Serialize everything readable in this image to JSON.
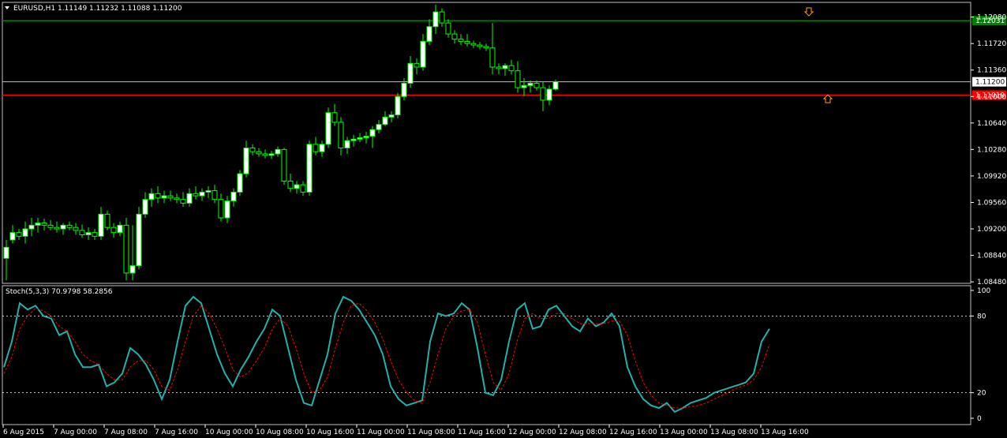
{
  "header": {
    "symbol_line": "EURUSD,H1  1.11149 1.11232 1.11088 1.11200",
    "stoch_line": "Stoch(5,3,3) 70.9798 58.2856"
  },
  "colors": {
    "background": "#000000",
    "bull_candle": "#ffffff",
    "bear_candle": "#000000",
    "candle_outline": "#00ff00",
    "wick": "#00ff00",
    "stoch_main": "#20b2aa",
    "stoch_signal": "#ff0000",
    "green_level": "#008000",
    "red_level": "#ff0000",
    "bid_line": "#c0c0c0",
    "arrow": "#ffa500",
    "grid_dotted": "#ffffff"
  },
  "chart_data": [
    {
      "type": "candlestick",
      "symbol": "EURUSD",
      "timeframe": "H1",
      "ylim": [
        1.0846,
        1.1228
      ],
      "y_ticks": [
        "1.12080",
        "1.11720",
        "1.11360",
        "1.11000",
        "1.10640",
        "1.10280",
        "1.09920",
        "1.09560",
        "1.09200",
        "1.08840",
        "1.08480"
      ],
      "price_labels": [
        {
          "name": "resistance",
          "value": 1.12031,
          "text": "1.12031",
          "color": "#008000"
        },
        {
          "name": "bid",
          "value": 1.112,
          "text": "1.11200",
          "color": "#ffffff"
        },
        {
          "name": "support",
          "value": 1.11019,
          "text": "1.11019",
          "color": "#ff0000"
        }
      ],
      "x_labels": [
        "6 Aug 2015",
        "7 Aug 00:00",
        "7 Aug 08:00",
        "7 Aug 16:00",
        "10 Aug 00:00",
        "10 Aug 08:00",
        "10 Aug 16:00",
        "11 Aug 00:00",
        "11 Aug 08:00",
        "11 Aug 16:00",
        "12 Aug 00:00",
        "12 Aug 08:00",
        "12 Aug 16:00",
        "13 Aug 00:00",
        "13 Aug 08:00",
        "13 Aug 16:00"
      ],
      "arrows": [
        {
          "direction": "down",
          "index": 170,
          "value": 1.1214
        },
        {
          "direction": "up",
          "index": 174,
          "value": 1.1098
        }
      ],
      "ohlc": [
        [
          1.088,
          1.0905,
          1.085,
          1.0895
        ],
        [
          1.0905,
          1.0925,
          1.09,
          1.0915
        ],
        [
          1.0915,
          1.092,
          1.0905,
          1.091
        ],
        [
          1.091,
          1.093,
          1.09,
          1.092
        ],
        [
          1.092,
          1.0935,
          1.091,
          1.0925
        ],
        [
          1.0925,
          1.0935,
          1.0915,
          1.0928
        ],
        [
          1.0928,
          1.0934,
          1.0918,
          1.0925
        ],
        [
          1.0925,
          1.0932,
          1.0918,
          1.0922
        ],
        [
          1.0922,
          1.093,
          1.0915,
          1.092
        ],
        [
          1.092,
          1.0928,
          1.0912,
          1.0925
        ],
        [
          1.0925,
          1.093,
          1.0918,
          1.0922
        ],
        [
          1.0922,
          1.0928,
          1.0912,
          1.0918
        ],
        [
          1.0918,
          1.0926,
          1.0908,
          1.0912
        ],
        [
          1.0912,
          1.0922,
          1.0905,
          1.0915
        ],
        [
          1.0915,
          1.092,
          1.0905,
          1.091
        ],
        [
          1.091,
          1.095,
          1.0905,
          1.094
        ],
        [
          1.094,
          1.0945,
          1.0918,
          1.0922
        ],
        [
          1.0922,
          1.0928,
          1.0908,
          1.0915
        ],
        [
          1.0915,
          1.093,
          1.091,
          1.0925
        ],
        [
          1.0925,
          1.0935,
          1.085,
          1.086
        ],
        [
          1.086,
          1.0925,
          1.085,
          1.087
        ],
        [
          1.087,
          1.095,
          1.0865,
          1.094
        ],
        [
          1.094,
          1.097,
          1.0935,
          1.096
        ],
        [
          1.096,
          1.0975,
          1.095,
          1.0968
        ],
        [
          1.0968,
          1.0978,
          1.0955,
          1.0962
        ],
        [
          1.0962,
          1.0972,
          1.0955,
          1.0965
        ],
        [
          1.0965,
          1.0972,
          1.0958,
          1.0962
        ],
        [
          1.0962,
          1.0968,
          1.0955,
          1.096
        ],
        [
          1.096,
          1.097,
          1.095,
          1.0955
        ],
        [
          1.0955,
          1.0975,
          1.095,
          1.0968
        ],
        [
          1.0968,
          1.0978,
          1.096,
          1.0965
        ],
        [
          1.0965,
          1.0975,
          1.0958,
          1.097
        ],
        [
          1.097,
          1.0978,
          1.0962,
          1.0972
        ],
        [
          1.0972,
          1.098,
          1.0955,
          1.096
        ],
        [
          1.096,
          1.0968,
          1.093,
          1.0935
        ],
        [
          1.0935,
          1.0965,
          1.0928,
          1.0958
        ],
        [
          1.0958,
          1.0975,
          1.095,
          1.097
        ],
        [
          1.097,
          1.1,
          1.0965,
          1.0995
        ],
        [
          1.0995,
          1.104,
          1.099,
          1.103
        ],
        [
          1.103,
          1.1035,
          1.102,
          1.1025
        ],
        [
          1.1025,
          1.103,
          1.1018,
          1.1022
        ],
        [
          1.1022,
          1.1028,
          1.1016,
          1.102
        ],
        [
          1.102,
          1.1026,
          1.1015,
          1.1022
        ],
        [
          1.1022,
          1.1032,
          1.1018,
          1.1028
        ],
        [
          1.1028,
          1.103,
          1.098,
          1.0985
        ],
        [
          1.0985,
          1.0995,
          1.097,
          1.0975
        ],
        [
          1.0975,
          1.0985,
          1.0968,
          1.098
        ],
        [
          1.098,
          1.0985,
          1.0965,
          1.097
        ],
        [
          1.097,
          1.104,
          1.0965,
          1.1035
        ],
        [
          1.1035,
          1.1045,
          1.102,
          1.1025
        ],
        [
          1.1025,
          1.104,
          1.1018,
          1.1035
        ],
        [
          1.1035,
          1.1085,
          1.103,
          1.1078
        ],
        [
          1.1078,
          1.109,
          1.106,
          1.1065
        ],
        [
          1.1065,
          1.1072,
          1.102,
          1.103
        ],
        [
          1.103,
          1.1045,
          1.1022,
          1.104
        ],
        [
          1.104,
          1.1048,
          1.1032,
          1.1042
        ],
        [
          1.1042,
          1.105,
          1.1038,
          1.1044
        ],
        [
          1.1044,
          1.1052,
          1.1036,
          1.1046
        ],
        [
          1.1046,
          1.106,
          1.103,
          1.1055
        ],
        [
          1.1055,
          1.1068,
          1.105,
          1.1062
        ],
        [
          1.1062,
          1.108,
          1.106,
          1.1072
        ],
        [
          1.1072,
          1.108,
          1.1065,
          1.1075
        ],
        [
          1.1075,
          1.1105,
          1.107,
          1.11
        ],
        [
          1.11,
          1.1125,
          1.1095,
          1.1118
        ],
        [
          1.1118,
          1.1155,
          1.1112,
          1.1145
        ],
        [
          1.1145,
          1.1152,
          1.113,
          1.114
        ],
        [
          1.114,
          1.1185,
          1.1135,
          1.1175
        ],
        [
          1.1175,
          1.1205,
          1.117,
          1.1195
        ],
        [
          1.1195,
          1.1225,
          1.1185,
          1.1215
        ],
        [
          1.1215,
          1.122,
          1.1195,
          1.12
        ],
        [
          1.12,
          1.1205,
          1.118,
          1.1185
        ],
        [
          1.1185,
          1.119,
          1.1172,
          1.1178
        ],
        [
          1.1178,
          1.1185,
          1.117,
          1.1175
        ],
        [
          1.1175,
          1.1185,
          1.1168,
          1.1172
        ],
        [
          1.1172,
          1.1176,
          1.1166,
          1.117
        ],
        [
          1.117,
          1.1174,
          1.1164,
          1.1168
        ],
        [
          1.1168,
          1.1172,
          1.1162,
          1.1166
        ],
        [
          1.1166,
          1.12,
          1.113,
          1.114
        ],
        [
          1.114,
          1.1145,
          1.113,
          1.1138
        ],
        [
          1.1138,
          1.1145,
          1.1128,
          1.1142
        ],
        [
          1.1142,
          1.115,
          1.113,
          1.1135
        ],
        [
          1.1135,
          1.1148,
          1.1105,
          1.1112
        ],
        [
          1.1112,
          1.1125,
          1.11,
          1.1115
        ],
        [
          1.1115,
          1.1122,
          1.1105,
          1.1118
        ],
        [
          1.1118,
          1.1122,
          1.1108,
          1.1112
        ],
        [
          1.1112,
          1.112,
          1.108,
          1.1095
        ],
        [
          1.1095,
          1.1115,
          1.1088,
          1.111
        ],
        [
          1.111,
          1.1123,
          1.1108,
          1.112
        ]
      ],
      "hidden_ohlc_note": ""
    },
    {
      "type": "line",
      "title": "Stoch(5,3,3)",
      "ylim": [
        0,
        100
      ],
      "y_ticks": [
        "100",
        "80",
        "20",
        "0"
      ],
      "levels": [
        80,
        20
      ],
      "series": [
        {
          "name": "main",
          "values": [
            40,
            60,
            90,
            85,
            88,
            80,
            78,
            65,
            68,
            50,
            40,
            40,
            42,
            25,
            28,
            35,
            55,
            50,
            42,
            30,
            15,
            30,
            60,
            88,
            95,
            90,
            70,
            50,
            35,
            25,
            38,
            48,
            60,
            70,
            85,
            80,
            55,
            30,
            12,
            10,
            30,
            50,
            82,
            95,
            92,
            85,
            75,
            65,
            50,
            25,
            15,
            10,
            12,
            14,
            60,
            82,
            80,
            82,
            90,
            85,
            55,
            20,
            18,
            30,
            60,
            85,
            90,
            70,
            72,
            85,
            88,
            80,
            72,
            68,
            78,
            72,
            75,
            82,
            72,
            40,
            25,
            15,
            10,
            8,
            12,
            5,
            8,
            12,
            14,
            16,
            20,
            22,
            24,
            26,
            28,
            35,
            60,
            70
          ]
        },
        {
          "name": "signal",
          "values": [
            35,
            48,
            70,
            80,
            86,
            84,
            80,
            72,
            68,
            60,
            50,
            45,
            42,
            35,
            30,
            30,
            40,
            45,
            45,
            38,
            25,
            22,
            38,
            60,
            80,
            88,
            82,
            70,
            55,
            38,
            32,
            36,
            45,
            55,
            70,
            78,
            72,
            55,
            35,
            20,
            22,
            32,
            55,
            75,
            88,
            90,
            84,
            75,
            62,
            45,
            30,
            20,
            14,
            12,
            28,
            50,
            70,
            80,
            84,
            85,
            75,
            50,
            28,
            22,
            35,
            60,
            78,
            82,
            78,
            78,
            82,
            82,
            78,
            74,
            74,
            74,
            74,
            76,
            76,
            65,
            45,
            28,
            18,
            12,
            10,
            8,
            8,
            9,
            10,
            12,
            15,
            18,
            21,
            24,
            26,
            30,
            40,
            58
          ]
        }
      ]
    }
  ]
}
